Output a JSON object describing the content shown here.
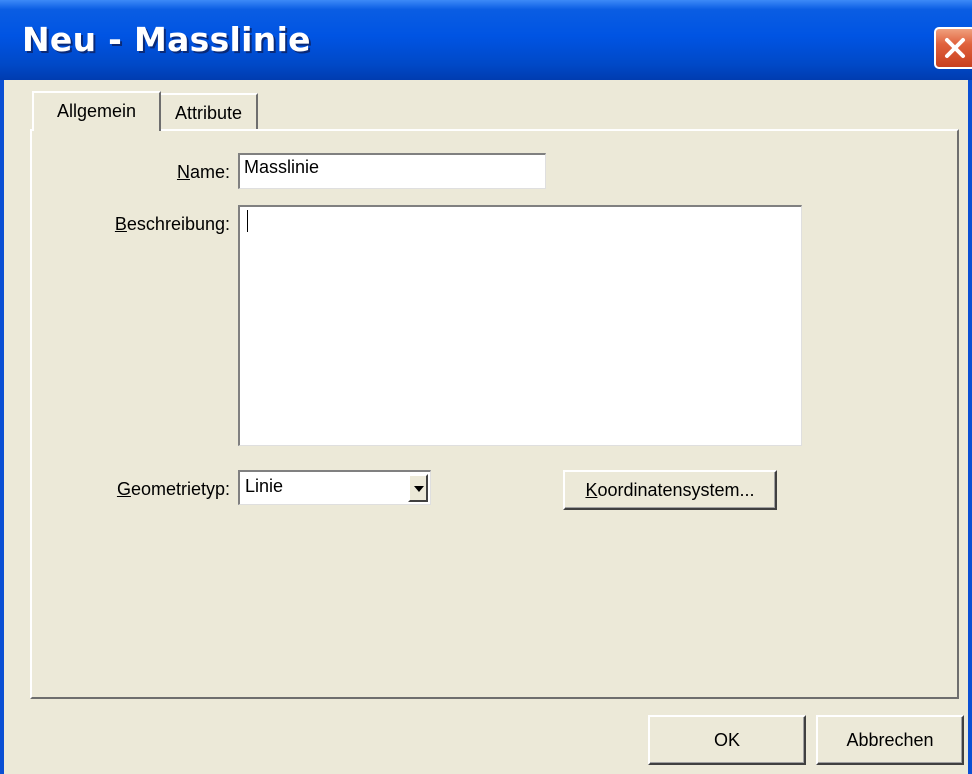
{
  "window": {
    "title": "Neu - Masslinie"
  },
  "tabs": [
    {
      "label": "Allgemein",
      "active": true
    },
    {
      "label": "Attribute",
      "active": false
    }
  ],
  "form": {
    "name_label_hotkey": "N",
    "name_label_rest": "ame:",
    "name_value": "Masslinie",
    "description_label_hotkey": "B",
    "description_label_rest": "eschreibung:",
    "description_value": "",
    "geometry_label_hotkey": "G",
    "geometry_label_rest": "eometrietyp:",
    "geometry_value": "Linie",
    "coord_button_hotkey": "K",
    "coord_button_rest": "oordinatensystem..."
  },
  "footer": {
    "ok_label": "OK",
    "cancel_label": "Abbrechen"
  },
  "colors": {
    "title_bar": "#0054e3",
    "dialog_bg": "#ece9d8",
    "close_button": "#e0623d"
  }
}
